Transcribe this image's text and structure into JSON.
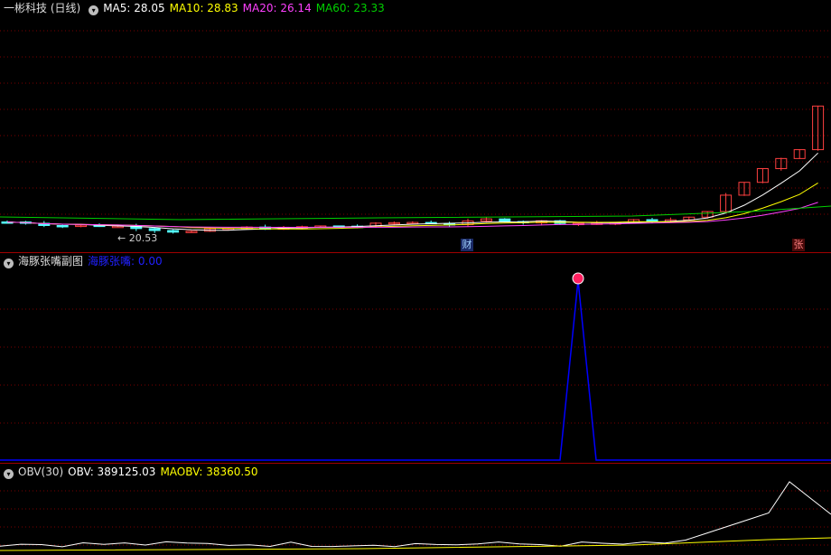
{
  "main": {
    "title": "一彬科技 (日线)",
    "ma5_label": "MA5: 28.05",
    "ma10_label": "MA10: 28.83",
    "ma20_label": "MA20: 26.14",
    "ma60_label": "MA60: 23.33",
    "low_marker": "20.53",
    "badge_cai": "财",
    "badge_zhang": "张"
  },
  "indicator": {
    "title": "海豚张嘴副图",
    "series_label": "海豚张嘴: 0.00"
  },
  "obv": {
    "title": "OBV(30)",
    "obv_label": "OBV: 389125.03",
    "maobv_label": "MAOBV: 38360.50"
  },
  "colors": {
    "up": "#ff4040",
    "down": "#54ffff",
    "ma5": "#ffffff",
    "ma10": "#ffff00",
    "ma20": "#ff40ff",
    "ma60": "#00d000",
    "indicator": "#0000ff",
    "grid": "#7a0000"
  }
}
